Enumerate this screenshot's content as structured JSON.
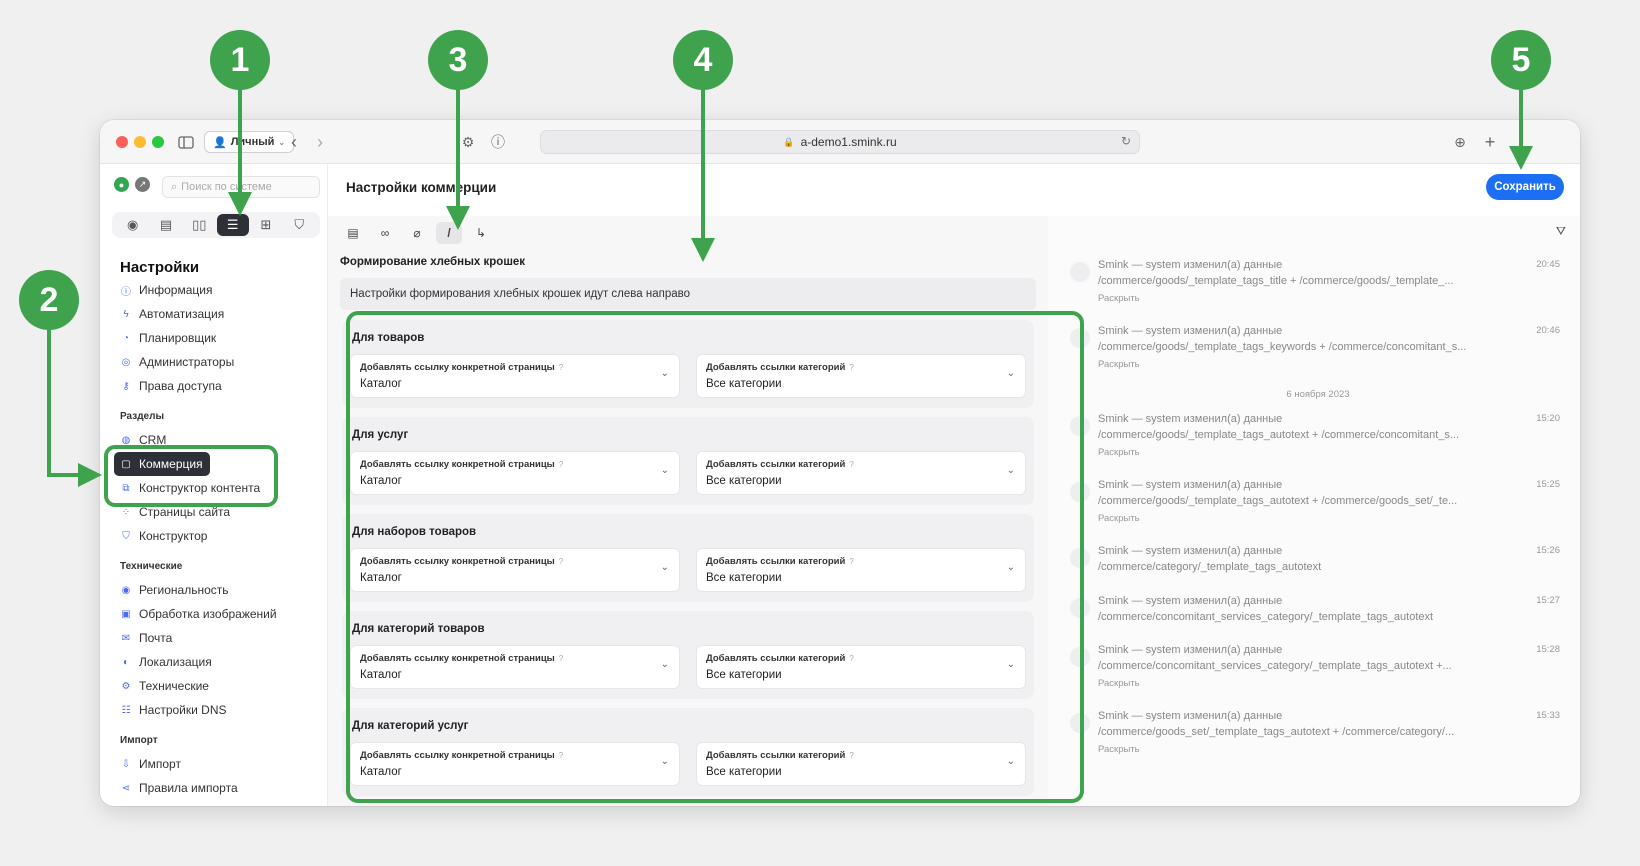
{
  "browser": {
    "profile_label": "Личный",
    "address": "a-demo1.smink.ru"
  },
  "sidebar": {
    "search_placeholder": "Поиск по системе",
    "heading": "Настройки",
    "items": [
      {
        "label": "Информация",
        "icon": "info-icon"
      },
      {
        "label": "Автоматизация",
        "icon": "bolt-icon"
      },
      {
        "label": "Планировщик",
        "icon": "clock-icon"
      },
      {
        "label": "Администраторы",
        "icon": "user-icon"
      },
      {
        "label": "Права доступа",
        "icon": "key-icon"
      }
    ],
    "group_sections": "Разделы",
    "section_items": [
      {
        "label": "CRM",
        "icon": "crm-icon"
      },
      {
        "label": "Коммерция",
        "icon": "bag-icon"
      },
      {
        "label": "Конструктор контента",
        "icon": "layers-icon"
      },
      {
        "label": "Страницы сайта",
        "icon": "grid-icon"
      },
      {
        "label": "Конструктор",
        "icon": "brush-icon"
      }
    ],
    "group_technical": "Технические",
    "technical_items": [
      {
        "label": "Региональность",
        "icon": "pin-icon"
      },
      {
        "label": "Обработка изображений",
        "icon": "image-icon"
      },
      {
        "label": "Почта",
        "icon": "mail-icon"
      },
      {
        "label": "Локализация",
        "icon": "globe-icon"
      },
      {
        "label": "Технические",
        "icon": "gear-icon"
      },
      {
        "label": "Настройки DNS",
        "icon": "dns-icon"
      }
    ],
    "group_import": "Импорт",
    "import_items": [
      {
        "label": "Импорт",
        "icon": "import-icon"
      },
      {
        "label": "Правила импорта",
        "icon": "share-icon"
      }
    ]
  },
  "main": {
    "title": "Настройки коммерции",
    "save_label": "Сохранить",
    "section_title": "Формирование хлебных крошек",
    "note": "Настройки формирования хлебных крошек идут слева направо",
    "field1_label": "Добавлять ссылку конкретной страницы",
    "field2_label": "Добавлять ссылки категорий",
    "help_mark": "?",
    "groups": [
      {
        "title": "Для товаров",
        "value1": "Каталог",
        "value2": "Все категории"
      },
      {
        "title": "Для услуг",
        "value1": "Каталог",
        "value2": "Все категории"
      },
      {
        "title": "Для наборов товаров",
        "value1": "Каталог",
        "value2": "Все категории"
      },
      {
        "title": "Для категорий товаров",
        "value1": "Каталог",
        "value2": "Все категории"
      },
      {
        "title": "Для категорий услуг",
        "value1": "Каталог",
        "value2": "Все категории"
      }
    ]
  },
  "log": {
    "who": "Smink — system изменил(а) данные",
    "expand": "Раскрыть",
    "date_divider": "6 ноября 2023",
    "entries": [
      {
        "path": "/commerce/goods/_template_tags_title + /commerce/goods/_template_...",
        "time": "20:45"
      },
      {
        "path": "/commerce/goods/_template_tags_keywords + /commerce/concomitant_s...",
        "time": "20:46"
      },
      {
        "path": "/commerce/goods/_template_tags_autotext + /commerce/concomitant_s...",
        "time": "15:20"
      },
      {
        "path": "/commerce/goods/_template_tags_autotext + /commerce/goods_set/_te...",
        "time": "15:25"
      },
      {
        "path": "/commerce/category/_template_tags_autotext",
        "time": "15:26"
      },
      {
        "path": "/commerce/concomitant_services_category/_template_tags_autotext",
        "time": "15:27"
      },
      {
        "path": "/commerce/concomitant_services_category/_template_tags_autotext +...",
        "time": "15:28"
      },
      {
        "path": "/commerce/goods_set/_template_tags_autotext + /commerce/category/...",
        "time": "15:33"
      }
    ]
  },
  "markers": [
    "1",
    "2",
    "3",
    "4",
    "5"
  ],
  "colors": {
    "annotation_green": "#3fa34d",
    "accent_blue": "#1c6ef2",
    "active_dark": "#2d3036"
  }
}
